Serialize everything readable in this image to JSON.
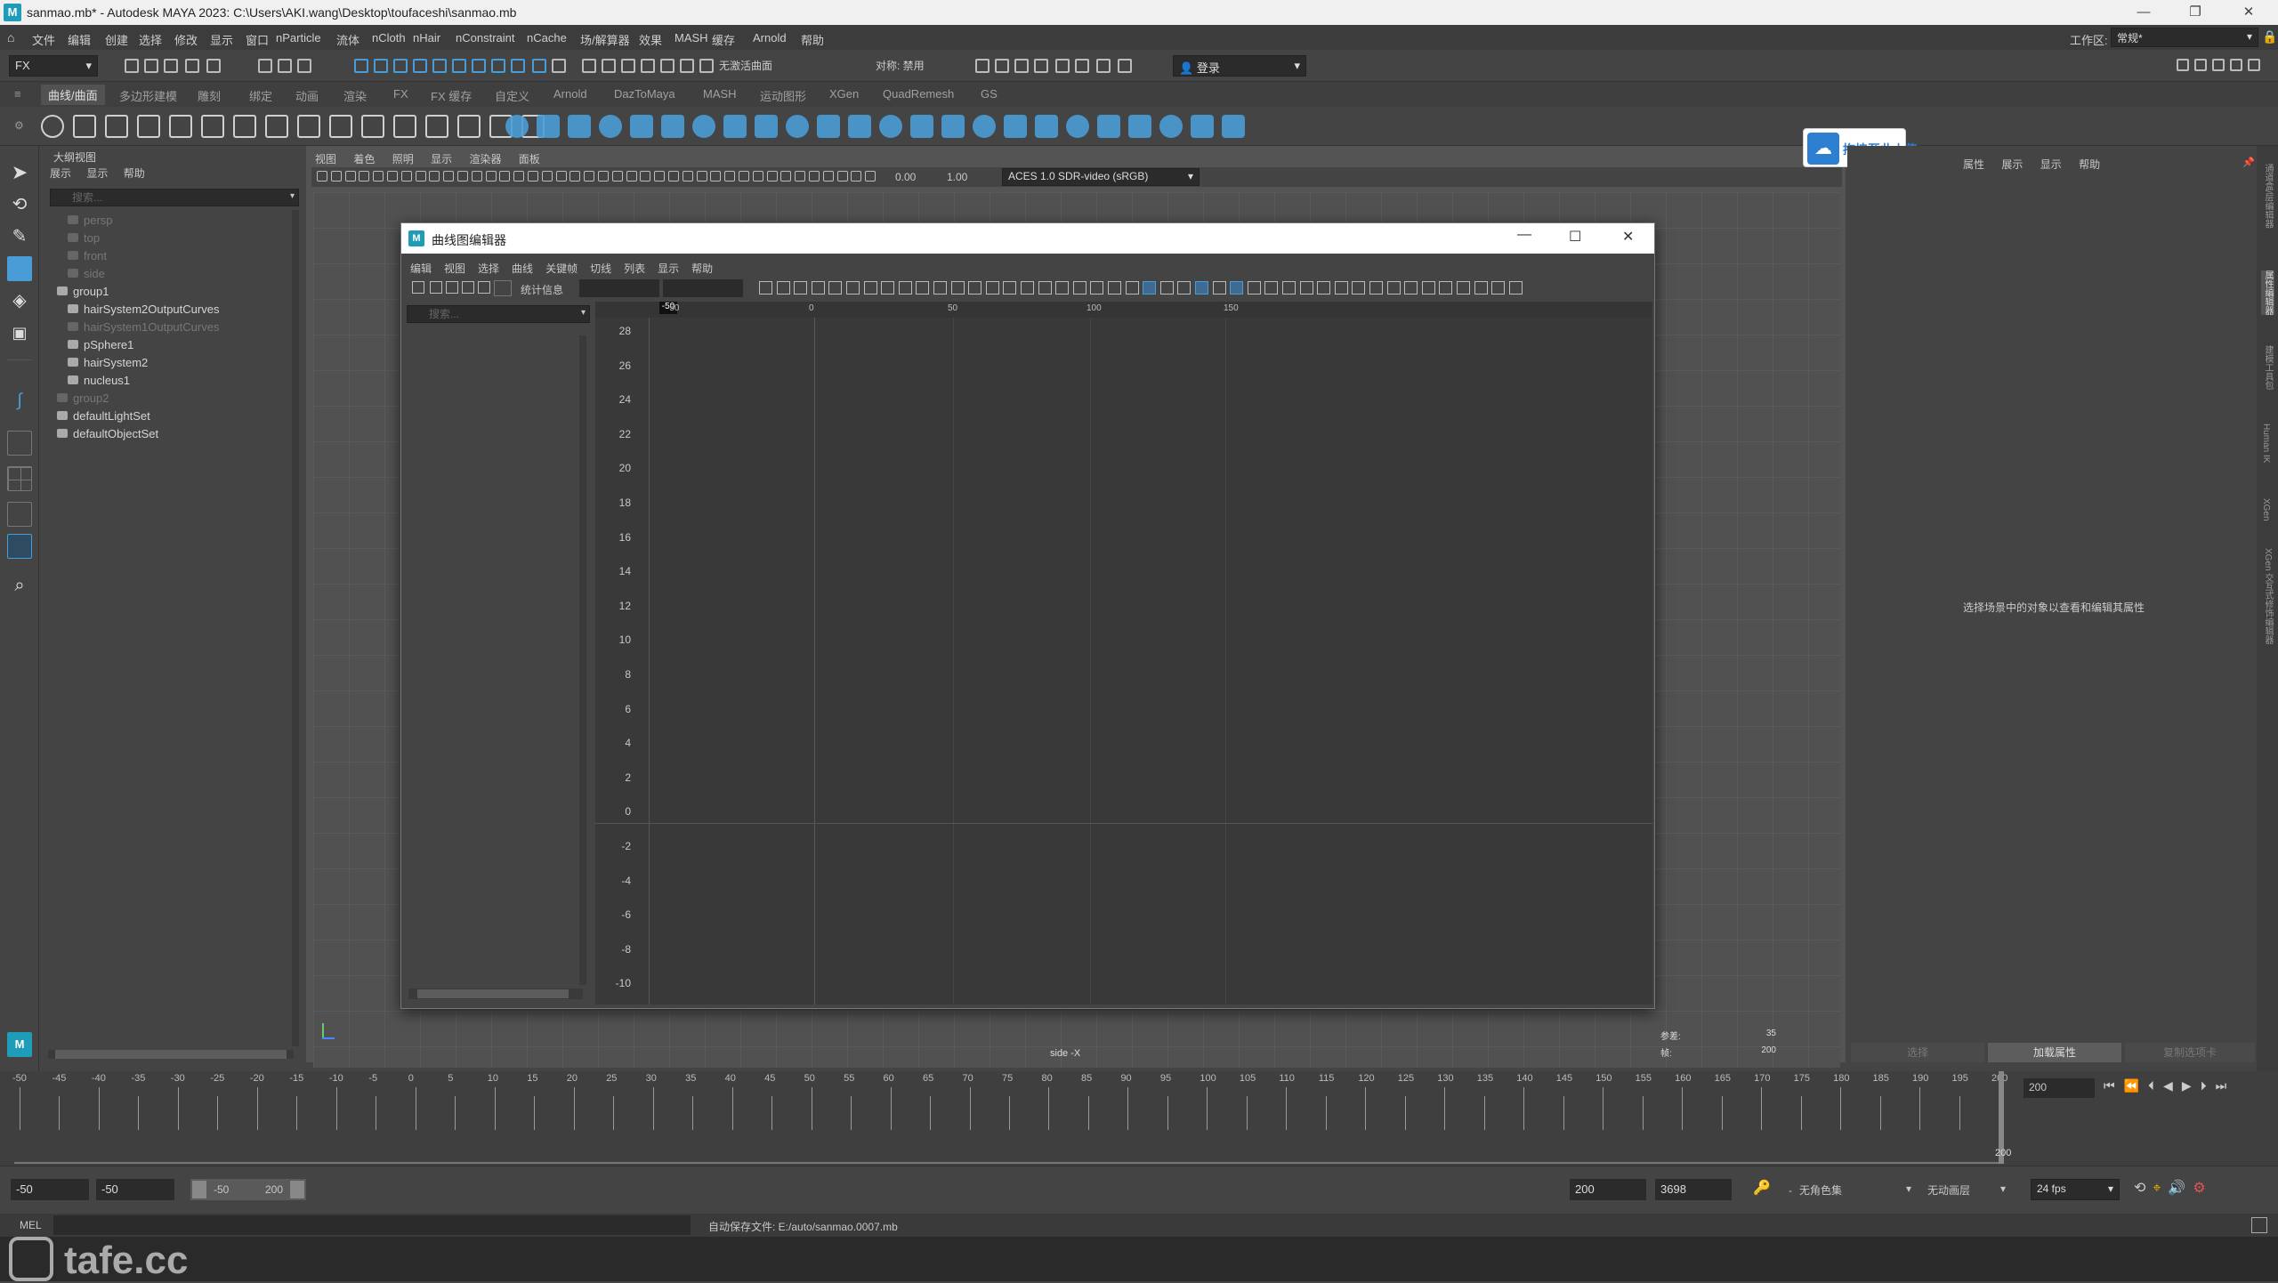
{
  "window": {
    "title": "sanmao.mb* - Autodesk MAYA 2023: C:\\Users\\AKI.wang\\Desktop\\toufaceshi\\sanmao.mb"
  },
  "menubar": {
    "items": [
      "文件",
      "编辑",
      "创建",
      "选择",
      "修改",
      "显示",
      "窗口",
      "nParticle",
      "流体",
      "nCloth",
      "nHair",
      "nConstraint",
      "nCache",
      "场/解算器",
      "效果",
      "MASH",
      "缓存",
      "Arnold",
      "帮助"
    ],
    "workspace_label": "工作区:",
    "workspace_value": "常规*"
  },
  "toolbar": {
    "mode": "FX",
    "symmetry": "对称: 禁用",
    "live_surface": "无激活曲面",
    "login": "登录"
  },
  "shelf_tabs": [
    "曲线/曲面",
    "多边形建模",
    "雕刻",
    "绑定",
    "动画",
    "渲染",
    "FX",
    "FX 缓存",
    "自定义",
    "Arnold",
    "DazToMaya",
    "MASH",
    "运动图形",
    "XGen",
    "QuadRemesh",
    "GS"
  ],
  "outliner": {
    "title": "大纲视图",
    "menus": [
      "展示",
      "显示",
      "帮助"
    ],
    "search_placeholder": "搜索...",
    "items": [
      {
        "label": "persp",
        "dim": true
      },
      {
        "label": "top",
        "dim": true
      },
      {
        "label": "front",
        "dim": true
      },
      {
        "label": "side",
        "dim": true
      },
      {
        "label": "group1",
        "dim": false
      },
      {
        "label": "hairSystem2OutputCurves",
        "dim": false
      },
      {
        "label": "hairSystem1OutputCurves",
        "dim": true
      },
      {
        "label": "pSphere1",
        "dim": false
      },
      {
        "label": "hairSystem2",
        "dim": false
      },
      {
        "label": "nucleus1",
        "dim": false
      },
      {
        "label": "group2",
        "dim": true
      },
      {
        "label": "defaultLightSet",
        "dim": false
      },
      {
        "label": "defaultObjectSet",
        "dim": false
      }
    ]
  },
  "viewport": {
    "menus": [
      "视图",
      "着色",
      "照明",
      "显示",
      "渲染器",
      "面板"
    ],
    "exposure": "0.00",
    "gamma": "1.00",
    "color_space": "ACES 1.0 SDR-video (sRGB)",
    "camera_label": "side -X",
    "hud": [
      {
        "label": "参差:",
        "value": "35"
      },
      {
        "label": "帧:",
        "value": "200"
      }
    ]
  },
  "upload_badge": {
    "label": "拖拽至此上传"
  },
  "graph_editor": {
    "title": "曲线图编辑器",
    "menus": [
      "编辑",
      "视图",
      "选择",
      "曲线",
      "关键帧",
      "切线",
      "列表",
      "显示",
      "帮助"
    ],
    "stats_label": "统计信息",
    "search_placeholder": "搜索...",
    "frame_marker": "-50",
    "x_ticks": [
      "-50",
      "0",
      "50",
      "100",
      "150"
    ],
    "y_ticks": [
      "28",
      "26",
      "24",
      "22",
      "20",
      "18",
      "16",
      "14",
      "12",
      "10",
      "8",
      "6",
      "4",
      "2",
      "0",
      "-2",
      "-4",
      "-6",
      "-8",
      "-10"
    ]
  },
  "attribute_editor": {
    "menus": [
      "属性",
      "展示",
      "显示",
      "帮助"
    ],
    "empty_message": "选择场景中的对象以查看和编辑其属性",
    "tabs": [
      "选择",
      "加载属性",
      "复制选项卡"
    ]
  },
  "right_strip": {
    "labels": [
      "通道盒/层编辑器",
      "属性编辑器",
      "建模工具包",
      "Human IK",
      "XGen",
      "XGen 交互式修饰编辑器"
    ]
  },
  "timeline": {
    "ticks": [
      "-50",
      "-45",
      "-40",
      "-35",
      "-30",
      "-25",
      "-20",
      "-15",
      "-10",
      "-5",
      "0",
      "5",
      "10",
      "15",
      "20",
      "25",
      "30",
      "35",
      "40",
      "45",
      "50",
      "55",
      "60",
      "65",
      "70",
      "75",
      "80",
      "85",
      "90",
      "95",
      "100",
      "105",
      "110",
      "115",
      "120",
      "125",
      "130",
      "135",
      "140",
      "145",
      "150",
      "155",
      "160",
      "165",
      "170",
      "175",
      "180",
      "185",
      "190",
      "195",
      "200"
    ],
    "current_frame": "200",
    "end_label": "200"
  },
  "range_slider": {
    "start": "-50",
    "playback_start": "-50",
    "range_start": "-50",
    "range_end": "200",
    "playback_end": "200",
    "end": "3698",
    "character_set": "无角色集",
    "anim_layer": "无动画层",
    "fps": "24 fps"
  },
  "command_line": {
    "label": "MEL",
    "message": "自动保存文件: E:/auto/sanmao.0007.mb"
  },
  "watermark": {
    "text": "tafe.cc"
  }
}
